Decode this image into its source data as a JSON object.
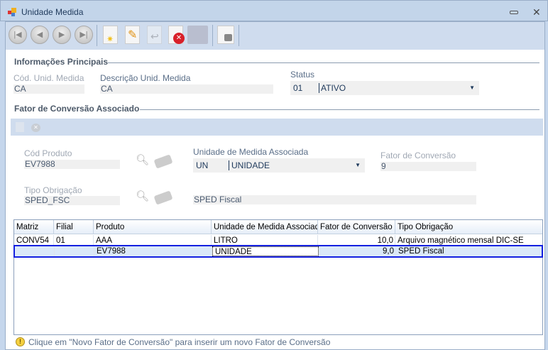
{
  "window": {
    "title": "Unidade Medida",
    "minimize_icon": "minimize-icon",
    "close_icon": "close-icon"
  },
  "toolbar": {
    "buttons": [
      "first-record",
      "previous-record",
      "next-record",
      "last-record",
      "new",
      "edit",
      "undo",
      "delete",
      "save",
      "lock"
    ]
  },
  "main": {
    "section_title": "Informações Principais",
    "cod_label": "Cód. Unid. Medida",
    "cod_value": "CA",
    "desc_label": "Descrição Unid. Medida",
    "desc_value": "CA",
    "status_label": "Status",
    "status_code": "01",
    "status_value": "ATIVO"
  },
  "fator": {
    "section_title": "Fator de Conversão Associado",
    "cod_produto_label": "Cód Produto",
    "cod_produto_value": "EV7988",
    "unidade_label": "Unidade de Medida Associada",
    "unidade_code": "UN",
    "unidade_value": "UNIDADE",
    "fator_label": "Fator de Conversão",
    "fator_value": "9",
    "tipo_label": "Tipo Obrigação",
    "tipo_value": "SPED_FSC",
    "tipo_desc": "SPED Fiscal"
  },
  "table": {
    "columns": [
      "Matriz",
      "Filial",
      "Produto",
      "Unidade de Medida Associada",
      "Fator de Conversão",
      "Tipo Obrigação"
    ],
    "rows": [
      [
        "CONV54",
        "01",
        "AAA",
        "LITRO",
        "10,0",
        "Arquivo magnético mensal DIC-SE"
      ],
      [
        "",
        "",
        "EV7988",
        "UNIDADE",
        "9,0",
        "SPED Fiscal"
      ]
    ],
    "selected_row": 1
  },
  "hint": "Clique em \"Novo Fator de Conversão\" para inserir um novo Fator de Conversão"
}
